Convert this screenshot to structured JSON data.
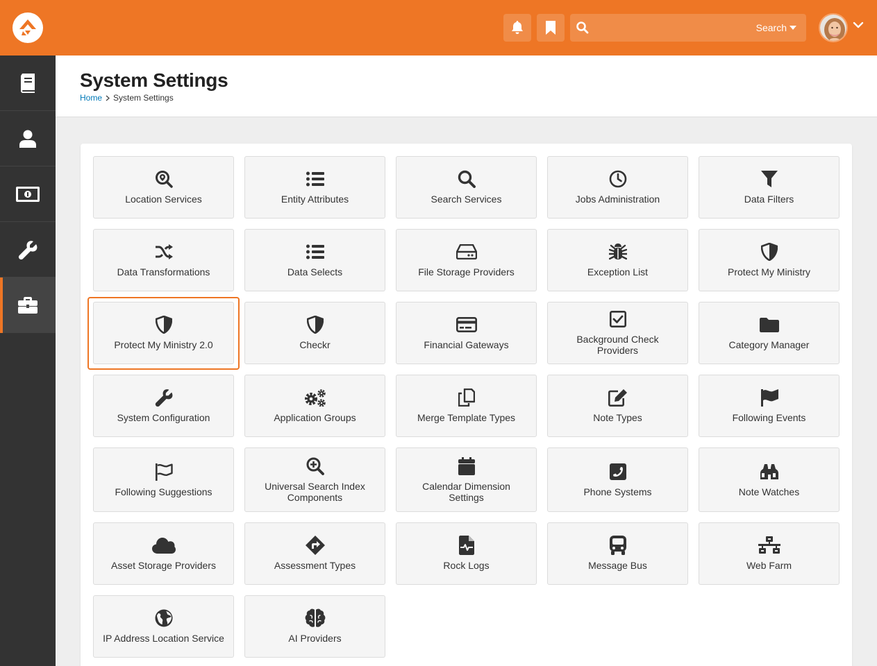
{
  "header": {
    "search_label": "Search"
  },
  "colors": {
    "accent": "#ee7625",
    "sidebar": "#333333",
    "link": "#0079b8"
  },
  "sidebar": {
    "items": [
      {
        "icon": "book-icon"
      },
      {
        "icon": "user-icon"
      },
      {
        "icon": "money-icon"
      },
      {
        "icon": "wrench-icon"
      },
      {
        "icon": "briefcase-icon",
        "active": true
      }
    ]
  },
  "page": {
    "title": "System Settings",
    "breadcrumb": [
      {
        "label": "Home"
      },
      {
        "label": "System Settings"
      }
    ]
  },
  "tiles": [
    {
      "label": "Location Services",
      "icon": "search-location-icon"
    },
    {
      "label": "Entity Attributes",
      "icon": "list-icon"
    },
    {
      "label": "Search Services",
      "icon": "search-icon"
    },
    {
      "label": "Jobs Administration",
      "icon": "clock-icon"
    },
    {
      "label": "Data Filters",
      "icon": "filter-icon"
    },
    {
      "label": "Data Transformations",
      "icon": "random-icon"
    },
    {
      "label": "Data Selects",
      "icon": "list-icon"
    },
    {
      "label": "File Storage Providers",
      "icon": "hdd-icon"
    },
    {
      "label": "Exception List",
      "icon": "bug-icon"
    },
    {
      "label": "Protect My Ministry",
      "icon": "shield-icon"
    },
    {
      "label": "Protect My Ministry 2.0",
      "icon": "shield-icon",
      "focused": true
    },
    {
      "label": "Checkr",
      "icon": "shield-icon"
    },
    {
      "label": "Financial Gateways",
      "icon": "credit-card-icon"
    },
    {
      "label": "Background Check Providers",
      "icon": "check-square-icon"
    },
    {
      "label": "Category Manager",
      "icon": "folder-icon"
    },
    {
      "label": "System Configuration",
      "icon": "wrench-icon"
    },
    {
      "label": "Application Groups",
      "icon": "cogs-icon"
    },
    {
      "label": "Merge Template Types",
      "icon": "copy-icon"
    },
    {
      "label": "Note Types",
      "icon": "edit-icon"
    },
    {
      "label": "Following Events",
      "icon": "flag-icon"
    },
    {
      "label": "Following Suggestions",
      "icon": "flag-outline-icon"
    },
    {
      "label": "Universal Search Index Components",
      "icon": "search-plus-icon"
    },
    {
      "label": "Calendar Dimension Settings",
      "icon": "calendar-icon"
    },
    {
      "label": "Phone Systems",
      "icon": "phone-square-icon"
    },
    {
      "label": "Note Watches",
      "icon": "binoculars-icon"
    },
    {
      "label": "Asset Storage Providers",
      "icon": "cloud-icon"
    },
    {
      "label": "Assessment Types",
      "icon": "directions-icon"
    },
    {
      "label": "Rock Logs",
      "icon": "file-medical-alt-icon"
    },
    {
      "label": "Message Bus",
      "icon": "bus-icon"
    },
    {
      "label": "Web Farm",
      "icon": "network-wired-icon"
    },
    {
      "label": "IP Address Location Service",
      "icon": "globe-icon"
    },
    {
      "label": "AI Providers",
      "icon": "brain-icon"
    }
  ]
}
